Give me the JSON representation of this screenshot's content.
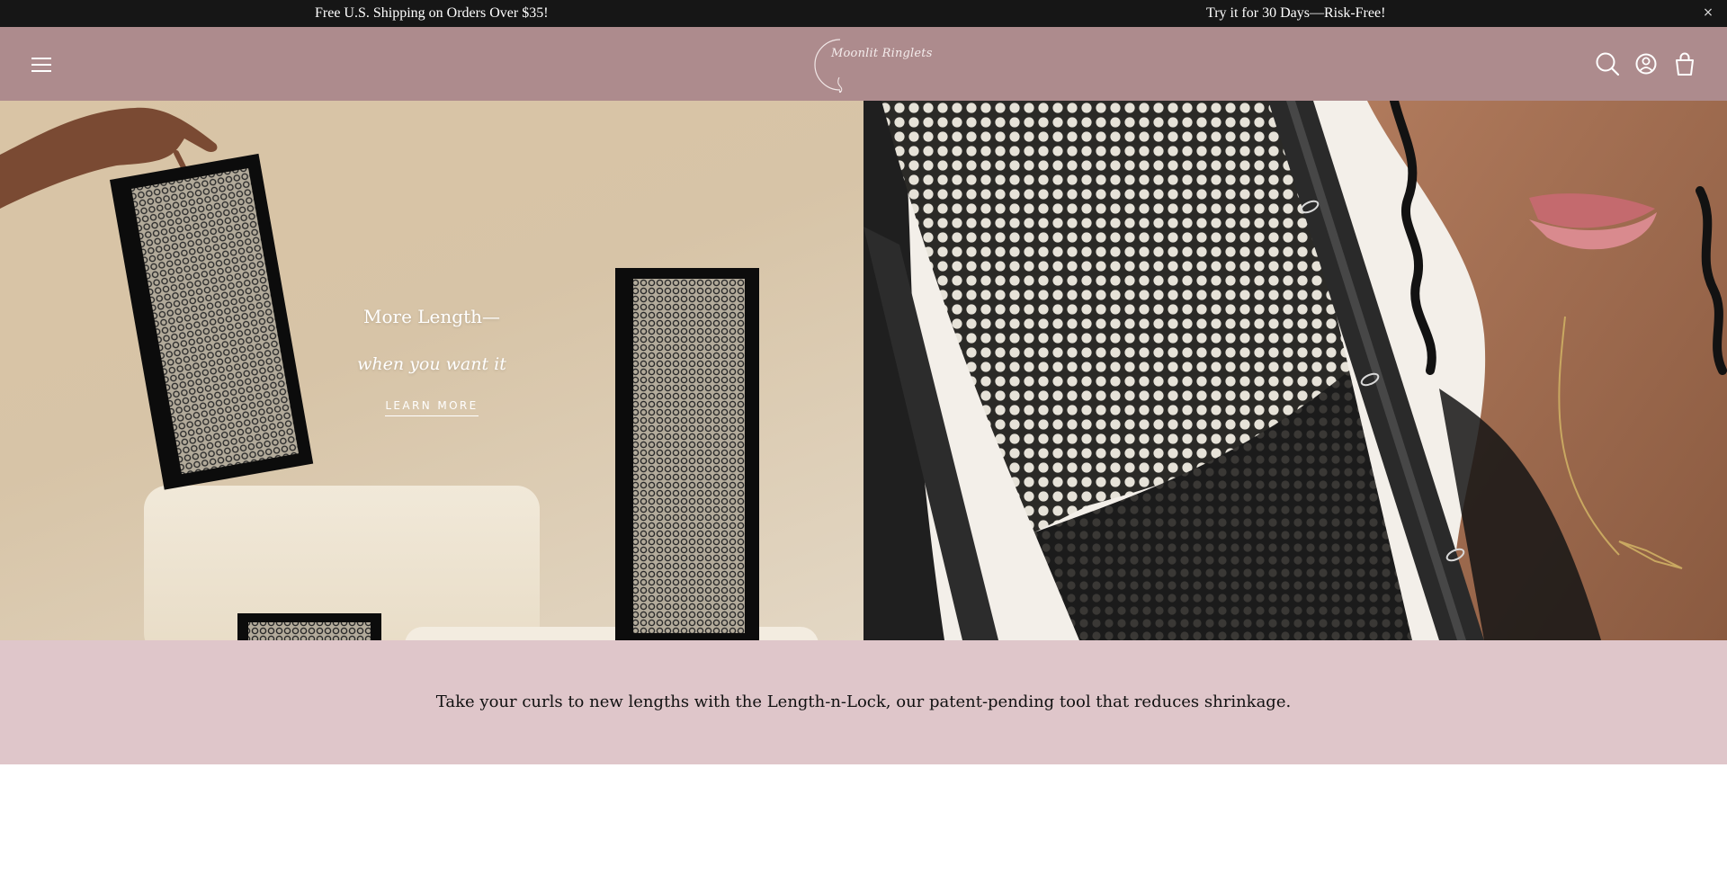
{
  "announcement": {
    "left_message": "Free U.S. Shipping on Orders Over $35!",
    "right_message": "Try it for 30 Days—Risk-Free!",
    "close_glyph": "×"
  },
  "header": {
    "menu_icon": "hamburger-menu-icon",
    "logo_text": "Moonlit Ringlets",
    "icons": [
      "search-icon",
      "account-icon",
      "cart-icon"
    ]
  },
  "hero": {
    "heading": "More Length—",
    "subheading": "when you want it",
    "cta_label": "LEARN MORE"
  },
  "tagline": {
    "text": "Take your curls to new lengths with the Length-n-Lock, our patent-pending tool that reduces shrinkage."
  },
  "colors": {
    "announcement_bg": "#161616",
    "header_bg": "#ad8b8d",
    "tagline_bg": "#dfc6ca",
    "text_light": "#ffffff"
  }
}
